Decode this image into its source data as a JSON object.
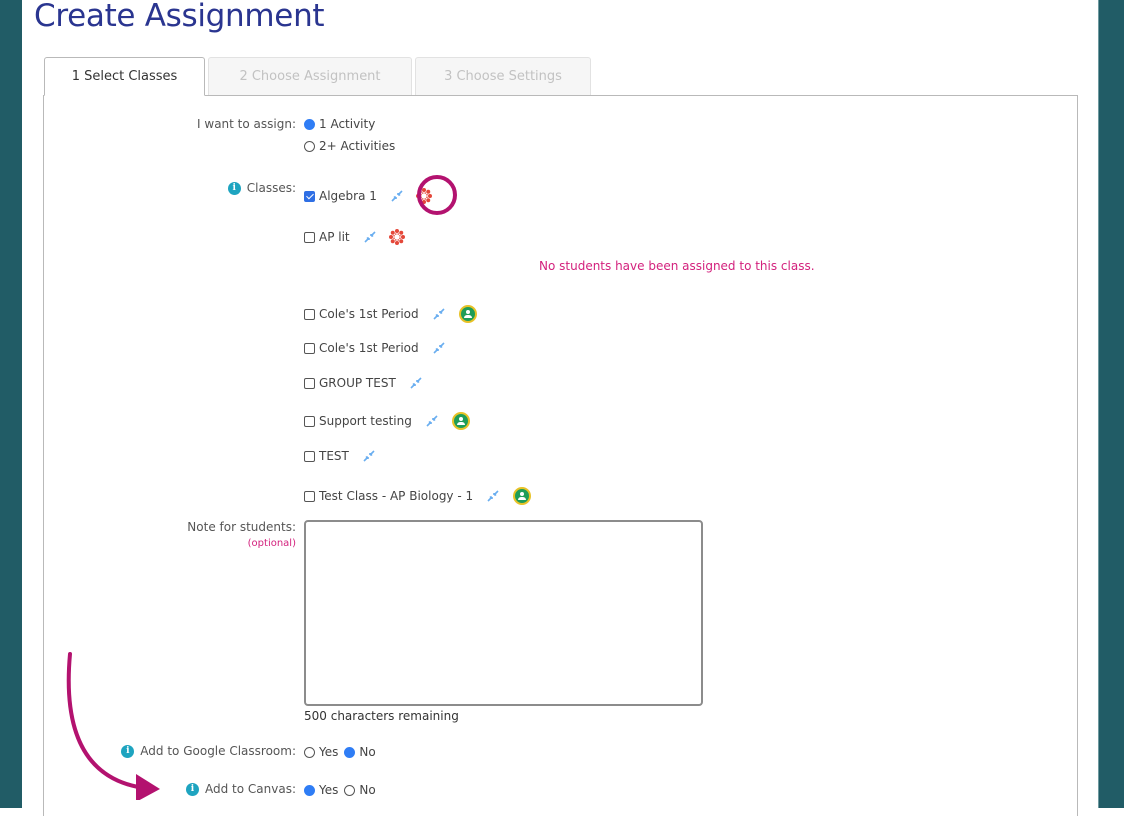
{
  "page": {
    "title": "Create Assignment",
    "colors": {
      "frame": "#215c66",
      "title": "#2a3590",
      "accent": "#d3217d",
      "radio_on": "#2f7df5",
      "info": "#1ea4c0",
      "annotation": "#b3126f"
    }
  },
  "tabs": [
    {
      "label": "1 Select Classes",
      "active": true
    },
    {
      "label": "2 Choose Assignment",
      "active": false
    },
    {
      "label": "3 Choose Settings",
      "active": false
    }
  ],
  "assign": {
    "label": "I want to assign:",
    "options": [
      {
        "label": "1 Activity",
        "selected": true
      },
      {
        "label": "2+ Activities",
        "selected": false
      }
    ]
  },
  "classes": {
    "label": "Classes:",
    "info_icon": "info-icon",
    "items": [
      {
        "name": "Algebra 1",
        "checked": true,
        "canvas": true,
        "google": false
      },
      {
        "name": "AP lit",
        "checked": false,
        "canvas": true,
        "google": false
      },
      {
        "name": "Cole's 1st Period",
        "checked": false,
        "canvas": false,
        "google": true
      },
      {
        "name": "Cole's 1st Period",
        "checked": false,
        "canvas": false,
        "google": false
      },
      {
        "name": "GROUP TEST",
        "checked": false,
        "canvas": false,
        "google": false
      },
      {
        "name": "Support testing",
        "checked": false,
        "canvas": false,
        "google": true
      },
      {
        "name": "TEST",
        "checked": false,
        "canvas": false,
        "google": false
      },
      {
        "name": "Test Class - AP Biology - 1",
        "checked": false,
        "canvas": false,
        "google": true
      }
    ],
    "warning": "No students have been assigned to this class."
  },
  "note": {
    "label": "Note for students:",
    "optional": "(optional)",
    "value": "",
    "char_count": "500 characters remaining"
  },
  "google_classroom": {
    "label": "Add to Google Classroom:",
    "options": [
      {
        "label": "Yes",
        "selected": false
      },
      {
        "label": "No",
        "selected": true
      }
    ]
  },
  "canvas": {
    "label": "Add to Canvas:",
    "options": [
      {
        "label": "Yes",
        "selected": true
      },
      {
        "label": "No",
        "selected": false
      }
    ]
  }
}
